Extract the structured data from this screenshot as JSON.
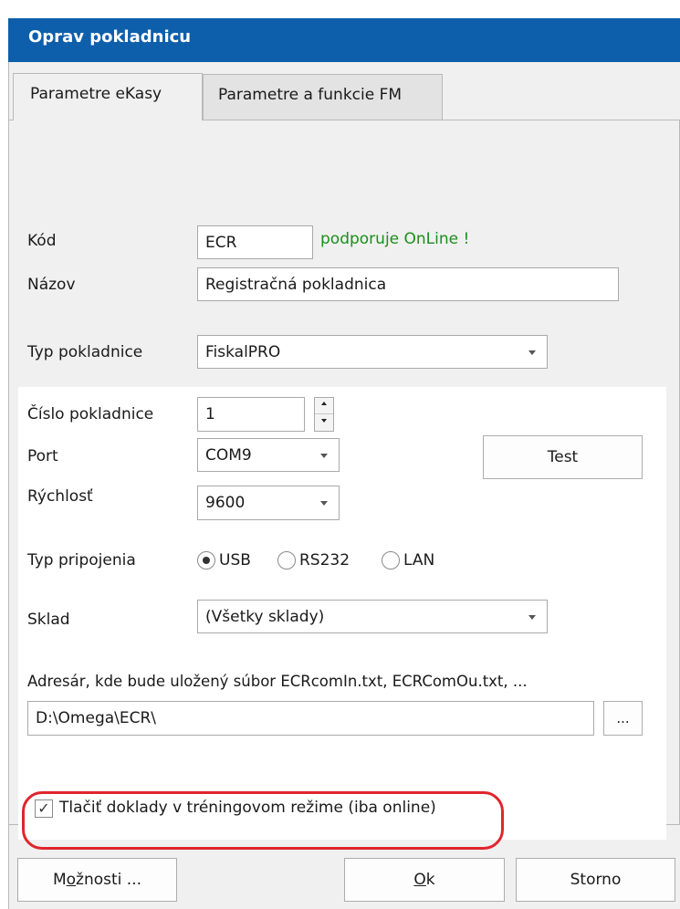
{
  "window": {
    "title": "Oprav pokladnicu"
  },
  "tabs": [
    {
      "label": "Parametre eKasy",
      "active": true
    },
    {
      "label": "Parametre a funkcie FM",
      "active": false
    }
  ],
  "form": {
    "kod": {
      "label": "Kód",
      "value": "ECR",
      "note": "podporuje OnLine !"
    },
    "nazov": {
      "label": "Názov",
      "value": "Registračná pokladnica"
    },
    "typ_pokladnice": {
      "label": "Typ pokladnice",
      "value": "FiskalPRO"
    },
    "cislo_pokladnice": {
      "label": "Číslo pokladnice",
      "value": "1"
    },
    "port": {
      "label": "Port",
      "value": "COM9"
    },
    "rychlost": {
      "label": "Rýchlosť",
      "value": "9600"
    },
    "test_button": "Test",
    "typ_pripojenia": {
      "label": "Typ pripojenia",
      "options": [
        "USB",
        "RS232",
        "LAN"
      ],
      "selected": "USB"
    },
    "sklad": {
      "label": "Sklad",
      "value": "(Všetky sklady)"
    },
    "adresar": {
      "label": "Adresár, kde bude uložený súbor ECRcomIn.txt, ECRComOu.txt, ...",
      "value": "D:\\Omega\\ECR\\",
      "browse_label": "..."
    },
    "training_mode": {
      "label": "Tlačiť doklady v tréningovom režime (iba online)",
      "checked": true
    }
  },
  "buttons": {
    "moznosti_pre": "M",
    "moznosti_ul": "o",
    "moznosti_post": "žnosti ...",
    "ok_ul": "O",
    "ok_post": "k",
    "storno": "Storno"
  },
  "colors": {
    "titlebar": "#0e5fab",
    "online_note": "#1a8f1a",
    "highlight": "#e0252d"
  }
}
